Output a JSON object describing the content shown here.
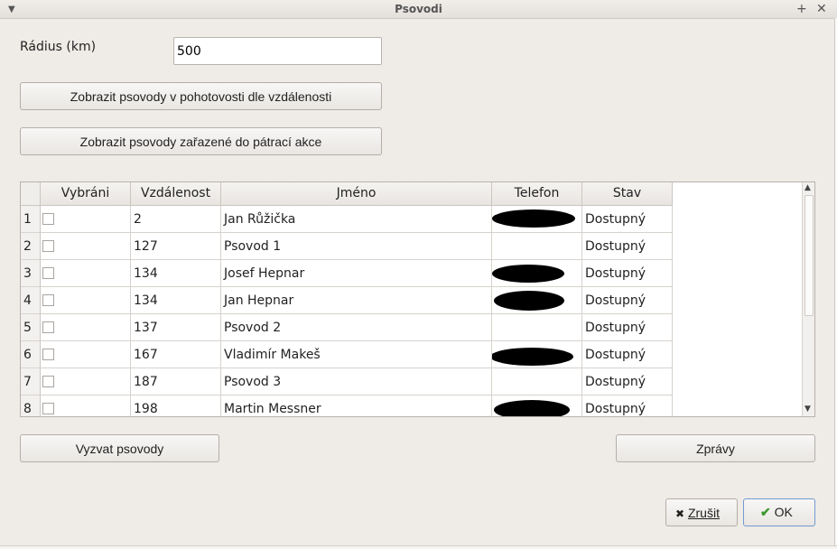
{
  "window": {
    "title": "Psovodi"
  },
  "form": {
    "radius_label": "Rádius (km)",
    "radius_value": "500"
  },
  "buttons": {
    "show_by_distance": "Zobrazit psovody v pohotovosti dle vzdálenosti",
    "show_in_action": "Zobrazit psovody zařazené do pátrací akce",
    "summon": "Vyzvat psovody",
    "messages": "Zprávy",
    "cancel": "Zrušit",
    "ok": "OK"
  },
  "table": {
    "columns": [
      "Vybráni",
      "Vzdálenost",
      "Jméno",
      "Telefon",
      "Stav"
    ],
    "rows": [
      {
        "num": "1",
        "distance": "2",
        "name": "Jan Růžička",
        "phone_redacted": true,
        "status": "Dostupný"
      },
      {
        "num": "2",
        "distance": "127",
        "name": " Psovod 1",
        "phone_redacted": false,
        "status": "Dostupný"
      },
      {
        "num": "3",
        "distance": "134",
        "name": "Josef Hepnar",
        "phone_redacted": true,
        "status": "Dostupný"
      },
      {
        "num": "4",
        "distance": "134",
        "name": "Jan Hepnar",
        "phone_redacted": true,
        "status": "Dostupný"
      },
      {
        "num": "5",
        "distance": "137",
        "name": " Psovod 2",
        "phone_redacted": false,
        "status": "Dostupný"
      },
      {
        "num": "6",
        "distance": "167",
        "name": "Vladimír Makeš",
        "phone_redacted": true,
        "status": "Dostupný"
      },
      {
        "num": "7",
        "distance": "187",
        "name": " Psovod 3",
        "phone_redacted": false,
        "status": "Dostupný"
      },
      {
        "num": "8",
        "distance": "198",
        "name": "Martin Messner",
        "phone_redacted": true,
        "status": "Dostupný"
      }
    ]
  },
  "icons": {
    "menu": "chevron-down-icon",
    "maximize": "plus-icon",
    "close": "close-icon",
    "cancel": "x-icon",
    "ok": "checkmark-icon"
  },
  "colors": {
    "ok_check": "#3c9a2f"
  }
}
